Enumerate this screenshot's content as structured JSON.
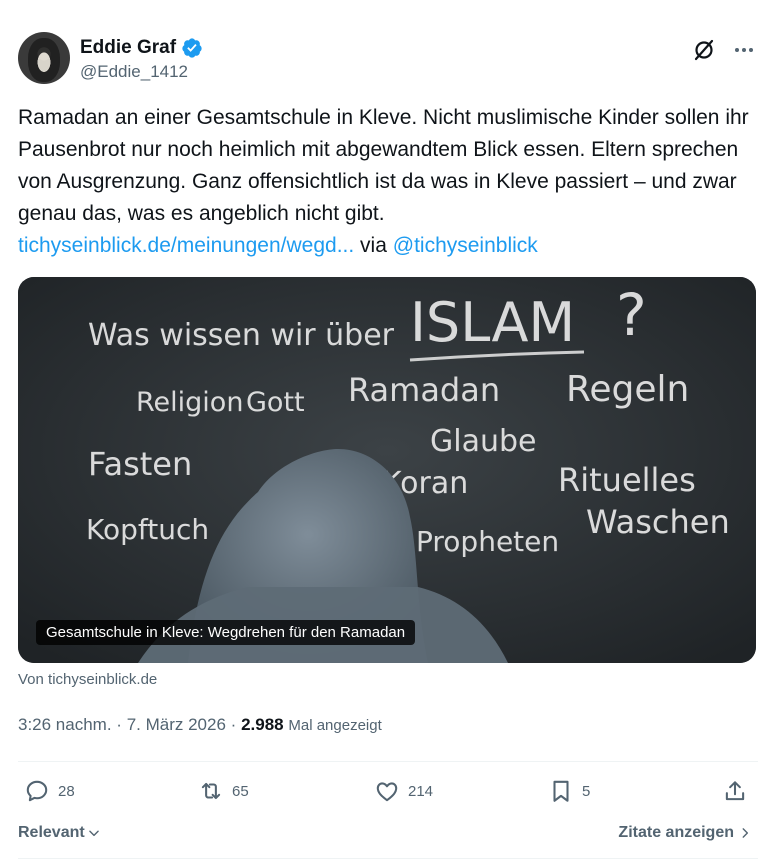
{
  "author": {
    "name": "Eddie Graf",
    "handle": "@Eddie_1412"
  },
  "tweet": {
    "text": "Ramadan an einer Gesamtschule in Kleve. Nicht muslimische Kinder sollen ihr Pausenbrot nur noch heimlich mit abgewandtem Blick essen. Eltern sprechen von Ausgrenzung. Ganz offensichtlich ist da was in Kleve passiert – und zwar genau das, was es angeblich nicht gibt.",
    "link": "tichyseinblick.de/meinungen/wegd...",
    "via": "via",
    "mention": "@tichyseinblick"
  },
  "card": {
    "caption": "Gesamtschule in Kleve: Wegdrehen für den Ramadan",
    "source": "Von tichyseinblick.de",
    "chalk": {
      "question": "Was wissen wir über",
      "islam": "ISLAM",
      "qmark": "?",
      "religion": "Religion",
      "gott": "Gott",
      "ramadan": "Ramadan",
      "regeln": "Regeln",
      "glaube": "Glaube",
      "fasten": "Fasten",
      "koran": "Koran",
      "rituelles": "Rituelles",
      "waschen": "Waschen",
      "kopftuch": "Kopftuch",
      "propheten": "Propheten"
    }
  },
  "meta": {
    "time": "3:26 nachm.",
    "sep1": "·",
    "date": "7. März 2026",
    "sep2": "·",
    "views": "2.988",
    "views_label": "Mal angezeigt"
  },
  "actions": {
    "replies": "28",
    "reposts": "65",
    "likes": "214",
    "bookmarks": "5"
  },
  "footer": {
    "relevant": "Relevant",
    "quotes": "Zitate anzeigen"
  },
  "colors": {
    "accent": "#1d9bf0",
    "muted": "#536471",
    "text": "#0f1419"
  }
}
